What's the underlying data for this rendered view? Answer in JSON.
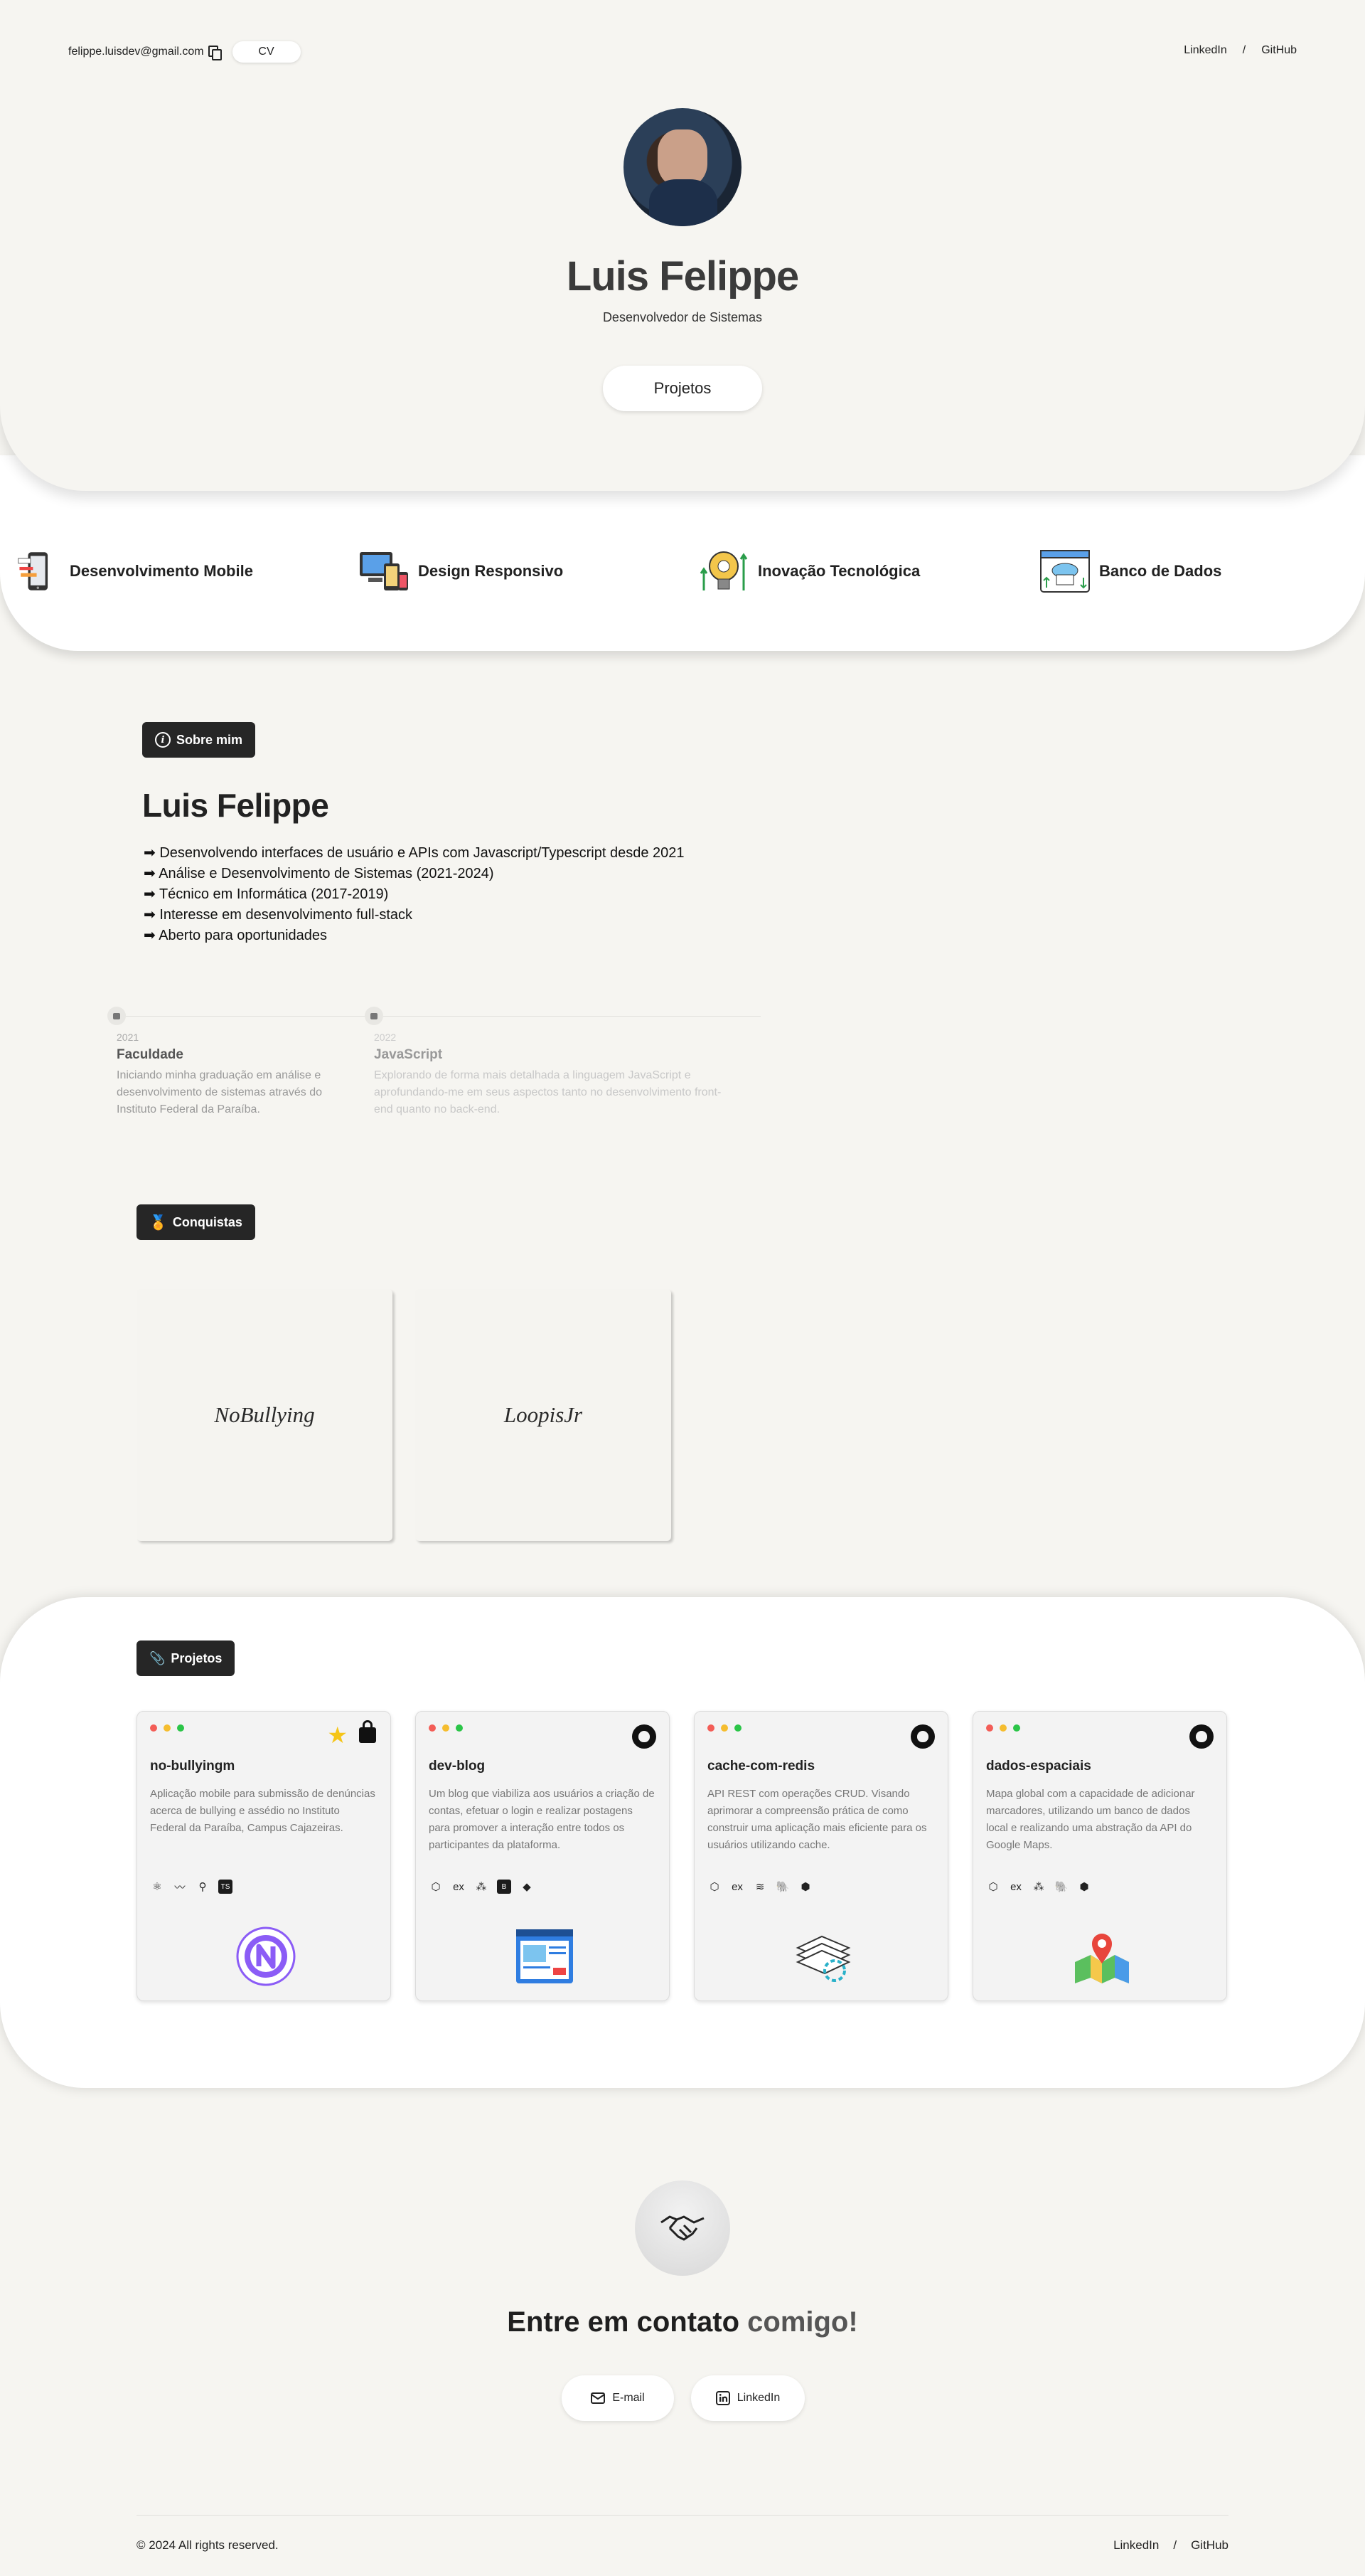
{
  "header": {
    "email": "felippe.luisdev@gmail.com",
    "cv_label": "CV",
    "links": [
      "LinkedIn",
      "/",
      "GitHub"
    ]
  },
  "hero": {
    "name": "Luis Felippe",
    "role": "Desenvolvedor de Sistemas",
    "projects_button": "Projetos"
  },
  "skills": [
    {
      "label": "Desenvolvimento Mobile",
      "icon": "mobile-dev-icon"
    },
    {
      "label": "Design Responsivo",
      "icon": "responsive-design-icon"
    },
    {
      "label": "Inovação Tecnológica",
      "icon": "innovation-icon"
    },
    {
      "label": "Banco de Dados",
      "icon": "api-database-icon"
    }
  ],
  "about": {
    "badge": "Sobre mim",
    "name": "Luis Felippe",
    "items": [
      "➡ Desenvolvendo interfaces de usuário e APIs com Javascript/Typescript desde 2021",
      "➡ Análise e Desenvolvimento de Sistemas (2021-2024)",
      "➡ Técnico em Informática (2017-2019)",
      "➡ Interesse em desenvolvimento full-stack",
      "➡ Aberto para oportunidades"
    ]
  },
  "timeline": [
    {
      "year": "2021",
      "title": "Faculdade",
      "desc": "Iniciando minha graduação em análise e desenvolvimento de sistemas através do Instituto Federal da Paraíba."
    },
    {
      "year": "2022",
      "title": "JavaScript",
      "desc": "Explorando de forma mais detalhada a linguagem JavaScript e aprofundando-me em seus aspectos tanto no desenvolvimento front-end quanto no back-end."
    }
  ],
  "achievements": {
    "badge": "Conquistas",
    "cards": [
      "NoBullying",
      "LoopisJr"
    ]
  },
  "projects": {
    "badge": "Projetos",
    "cards": [
      {
        "title": "no-bullyingm",
        "desc": "Aplicação mobile para submissão de denúncias acerca de bullying e assédio no Instituto Federal da Paraíba, Campus Cajazeiras.",
        "tech": [
          "⚛",
          "〰",
          "⚲",
          "TS"
        ]
      },
      {
        "title": "dev-blog",
        "desc": "Um blog que viabiliza aos usuários a criação de contas, efetuar o login e realizar postagens para promover a interação entre todos os participantes da plataforma.",
        "tech": [
          "⬡",
          "ex",
          "⁂",
          "B",
          "◆"
        ]
      },
      {
        "title": "cache-com-redis",
        "desc": "API REST com operações CRUD. Visando aprimorar a compreensão prática de como construir uma aplicação mais eficiente para os usuários utilizando cache.",
        "tech": [
          "⬡",
          "ex",
          "≋",
          "🐘",
          "⬢"
        ]
      },
      {
        "title": "dados-espaciais",
        "desc": "Mapa global com a capacidade de adicionar marcadores, utilizando um banco de dados local e realizando uma abstração da API do Google Maps.",
        "tech": [
          "⬡",
          "ex",
          "⁂",
          "🐘",
          "⬢"
        ]
      }
    ]
  },
  "contact": {
    "title_main": "Entre em contato",
    "title_muted": "comigo!",
    "email_label": "E-mail",
    "linkedin_label": "LinkedIn"
  },
  "footer": {
    "copyright": "© 2024 All rights reserved.",
    "links": [
      "LinkedIn",
      "/",
      "GitHub"
    ]
  },
  "colors": {
    "background": "#f6f5f1",
    "badge": "#262626",
    "dot_red": "#f35d57",
    "dot_yellow": "#f5bd2f",
    "dot_green": "#2bc548"
  }
}
